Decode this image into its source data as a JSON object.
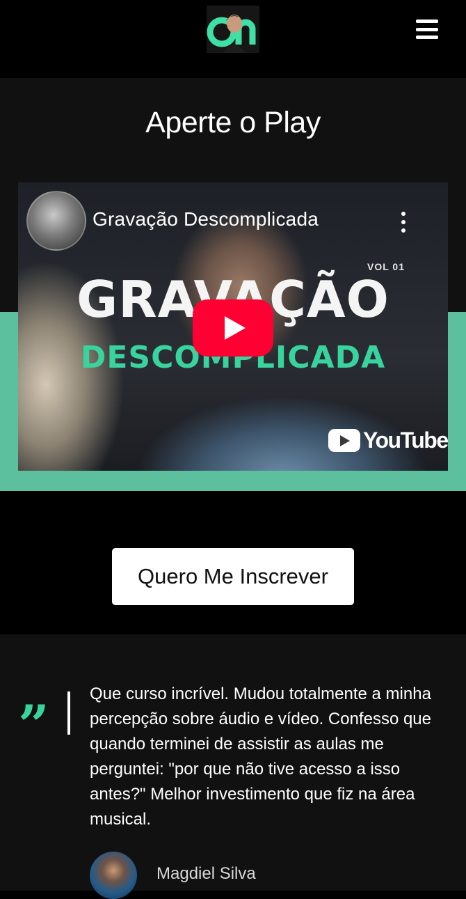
{
  "header": {
    "logo_icon": "avatar-logo-icon",
    "menu_icon": "hamburger-menu-icon"
  },
  "video_section": {
    "title": "Aperte o Play",
    "video": {
      "title": "Gravação Descomplicada",
      "thumbnail_vol": "VOL 01",
      "thumbnail_line1": "GRAVAÇÃO",
      "thumbnail_line2": "DESCOMPLICADA",
      "brand": "YouTube"
    },
    "accent_color": "#5cbf9d"
  },
  "cta": {
    "label": "Quero Me Inscrever"
  },
  "testimonial": {
    "quote": "Que curso incrível. Mudou totalmente a minha percepção sobre áudio e vídeo. Confesso que quando terminei de assistir as aulas me perguntei: \"por que não tive acesso a isso antes?\" Melhor investimento que fiz na área musical.",
    "author": "Magdiel Silva",
    "quote_color": "#39d39d"
  }
}
